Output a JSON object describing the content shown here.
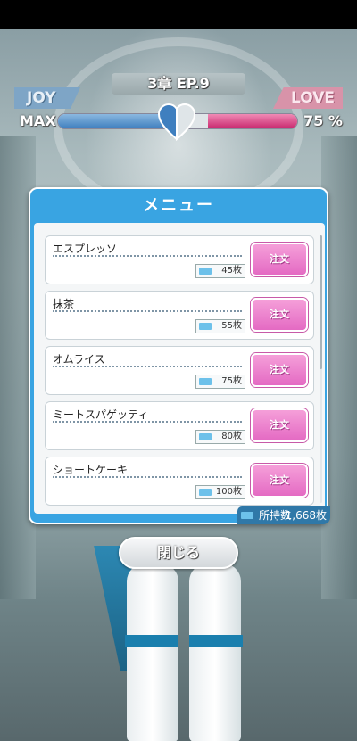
{
  "hud": {
    "chapter": "3章 EP.9",
    "joy_label": "JOY",
    "love_label": "LOVE",
    "max_label": "MAX",
    "love_percent": "75 %",
    "joy_level": 1.0,
    "love_level": 0.75
  },
  "menu": {
    "title": "メニュー",
    "order_label": "注文",
    "items": [
      {
        "name": "エスプレッソ",
        "price": "45枚"
      },
      {
        "name": "抹茶",
        "price": "55枚"
      },
      {
        "name": "オムライス",
        "price": "75枚"
      },
      {
        "name": "ミートスパゲッティ",
        "price": "80枚"
      },
      {
        "name": "ショートケーキ",
        "price": "100枚"
      }
    ],
    "owned_label": "所持数",
    "owned_count": "1,668枚"
  },
  "close_label": "閉じる",
  "colors": {
    "accent_blue": "#39a4e2",
    "order_pink": "#e46ac3",
    "joy_blue": "#3f7fbf",
    "love_pink": "#c8286f"
  },
  "icons": [
    "ticket-icon",
    "heart-icon"
  ]
}
